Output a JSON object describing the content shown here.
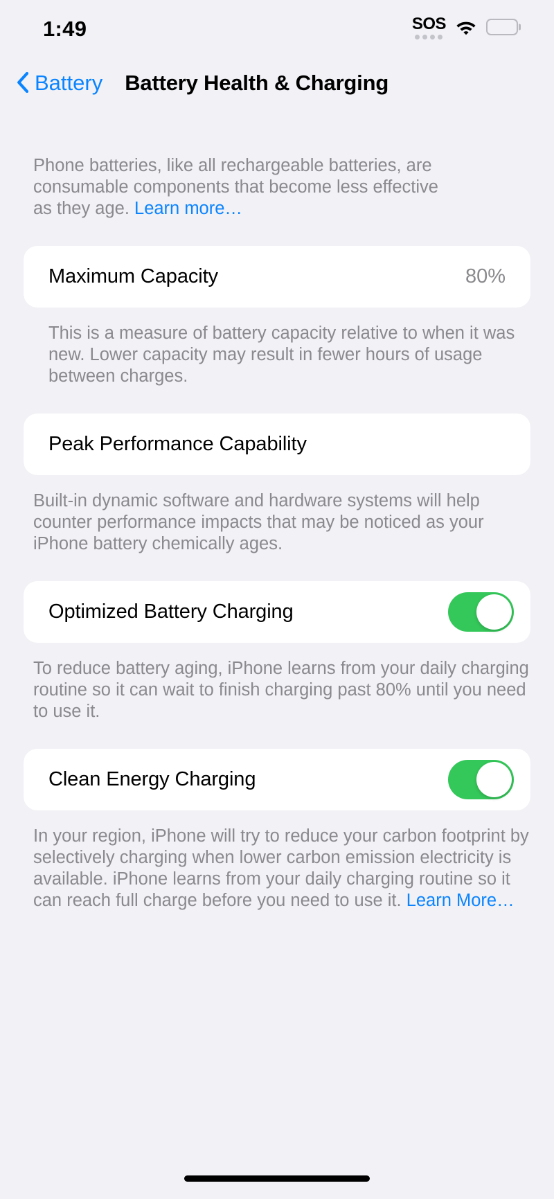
{
  "status_bar": {
    "time": "1:49",
    "sos_label": "SOS",
    "sos_dots": 4,
    "wifi_icon": "wifi-icon",
    "battery_icon": "battery-full-icon"
  },
  "nav": {
    "back_icon": "chevron-left-icon",
    "back_label": "Battery",
    "title": "Battery Health & Charging"
  },
  "intro": {
    "text": "Phone batteries, like all rechargeable batteries, are consumable components that become less effective as they age. ",
    "link_label": "Learn more…"
  },
  "sections": {
    "maximum_capacity": {
      "label": "Maximum Capacity",
      "value": "80%",
      "footer": "This is a measure of battery capacity relative to when it was new. Lower capacity may result in fewer hours of usage between charges."
    },
    "peak_performance": {
      "label": "Peak Performance Capability",
      "footer": "Built-in dynamic software and hardware systems will help counter performance impacts that may be noticed as your iPhone battery chemically ages."
    },
    "optimized_battery_charging": {
      "label": "Optimized Battery Charging",
      "toggle_state": "on",
      "footer": "To reduce battery aging, iPhone learns from your daily charging routine so it can wait to finish charging past 80% until you need to use it."
    },
    "clean_energy_charging": {
      "label": "Clean Energy Charging",
      "toggle_state": "on",
      "footer": "In your region, iPhone will try to reduce your carbon footprint by selectively charging when lower carbon emission electricity is available. iPhone learns from your daily charging routine so it can reach full charge before you need to use it. ",
      "footer_link_label": "Learn More…"
    }
  },
  "colors": {
    "background": "#F1F1F6",
    "card": "#FFFFFF",
    "accent_blue": "#0A84FF",
    "toggle_green": "#34C759",
    "secondary_text": "#8A8A8E"
  },
  "home_indicator": "home-indicator"
}
